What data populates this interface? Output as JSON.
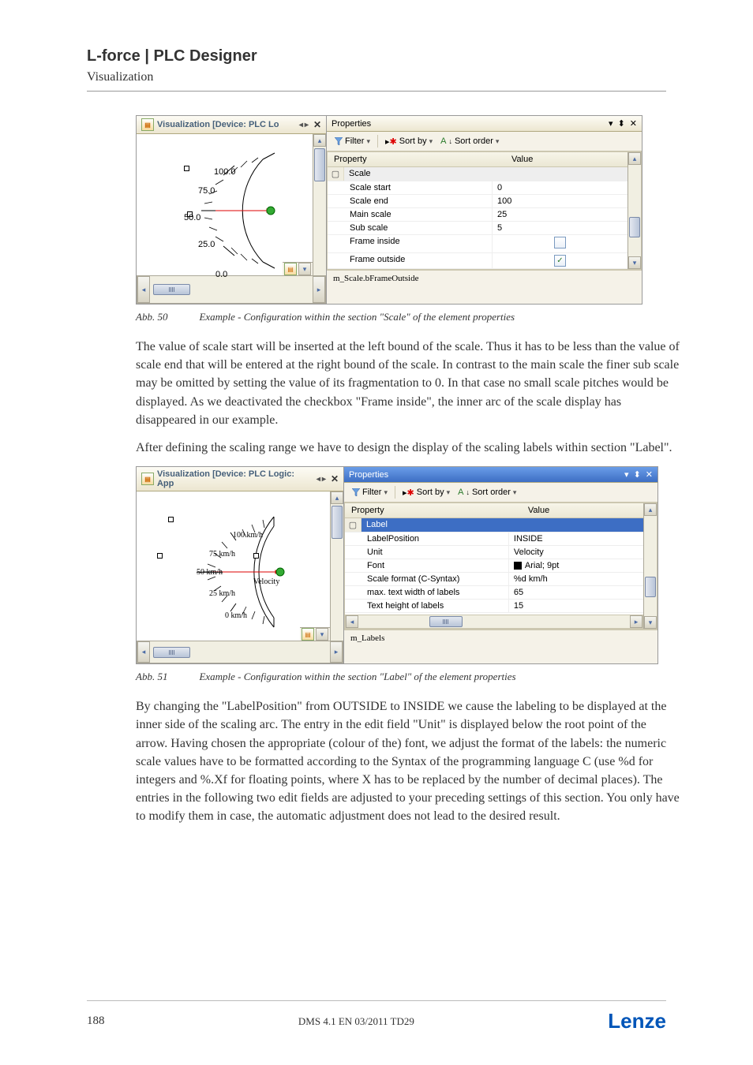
{
  "header": {
    "title": "L-force | PLC Designer",
    "subtitle": "Visualization"
  },
  "screenshot1": {
    "tab_title": "Visualization [Device: PLC Lo",
    "gauge_labels": [
      "100.0",
      "75.0",
      "50.0",
      "25.0",
      "0.0"
    ],
    "properties_title": "Properties",
    "toolbar": {
      "filter": "Filter",
      "sort_by": "Sort by",
      "sort_order": "Sort order"
    },
    "grid_header": {
      "property": "Property",
      "value": "Value"
    },
    "group": "Scale",
    "rows": [
      {
        "p": "Scale start",
        "v": "0"
      },
      {
        "p": "Scale end",
        "v": "100"
      },
      {
        "p": "Main scale",
        "v": "25"
      },
      {
        "p": "Sub scale",
        "v": "5"
      },
      {
        "p": "Frame inside",
        "v_checkbox": false
      },
      {
        "p": "Frame outside",
        "v_checkbox": true
      }
    ],
    "desc": "m_Scale.bFrameOutside"
  },
  "caption1": {
    "num": "Abb. 50",
    "text": "Example - Configuration within the section \"Scale\" of the element properties"
  },
  "para1": "The value of scale start will be inserted at the left bound of the scale. Thus it has to be less than the value of scale end that will be entered at the right bound of the scale. In contrast to the main scale the finer sub scale may be omitted by setting the value of its fragmentation to 0. In that case no small scale pitches would be displayed. As we deactivated the checkbox \"Frame inside\", the inner arc of the scale display has disappeared in our example.",
  "para2": "After defining the scaling range we have to design the display of the scaling labels within section \"Label\".",
  "screenshot2": {
    "tab_title": "Visualization [Device: PLC Logic: App",
    "properties_title": "Properties",
    "toolbar": {
      "filter": "Filter",
      "sort_by": "Sort by",
      "sort_order": "Sort order"
    },
    "grid_header": {
      "property": "Property",
      "value": "Value"
    },
    "group": "Label",
    "rows": [
      {
        "p": "LabelPosition",
        "v": "INSIDE"
      },
      {
        "p": "Unit",
        "v": "Velocity"
      },
      {
        "p": "Font",
        "v": "Arial; 9pt",
        "swatch": true
      },
      {
        "p": "Scale format (C-Syntax)",
        "v": "%d km/h"
      },
      {
        "p": "max. text width of labels",
        "v": "65"
      },
      {
        "p": "Text height of labels",
        "v": "15"
      }
    ],
    "desc": "m_Labels",
    "gauge_labels": [
      "100 km/h",
      "75 km/h",
      "50 km/h",
      "25 km/h",
      "0 km/h"
    ],
    "gauge_unit": "Velocity"
  },
  "caption2": {
    "num": "Abb. 51",
    "text": "Example - Configuration within the section \"Label\" of the element properties"
  },
  "para3": "By changing the \"LabelPosition\" from OUTSIDE to INSIDE we cause the labeling to be displayed at the inner side of the scaling arc. The entry in the edit field \"Unit\" is displayed below the root point of the arrow.  Having chosen the appropriate (colour of the) font, we adjust the format of the labels: the numeric scale values have to be formatted according to the Syntax of the programming language C  (use %d for integers and %.Xf for floating points, where X has to be replaced by the number of decimal places).  The entries in the following two edit fields are adjusted to your preceding settings of this section. You only have to modify them in case, the automatic adjustment does not lead to the desired result.",
  "footer": {
    "page": "188",
    "docid": "DMS 4.1 EN 03/2011 TD29",
    "logo": "Lenze"
  }
}
